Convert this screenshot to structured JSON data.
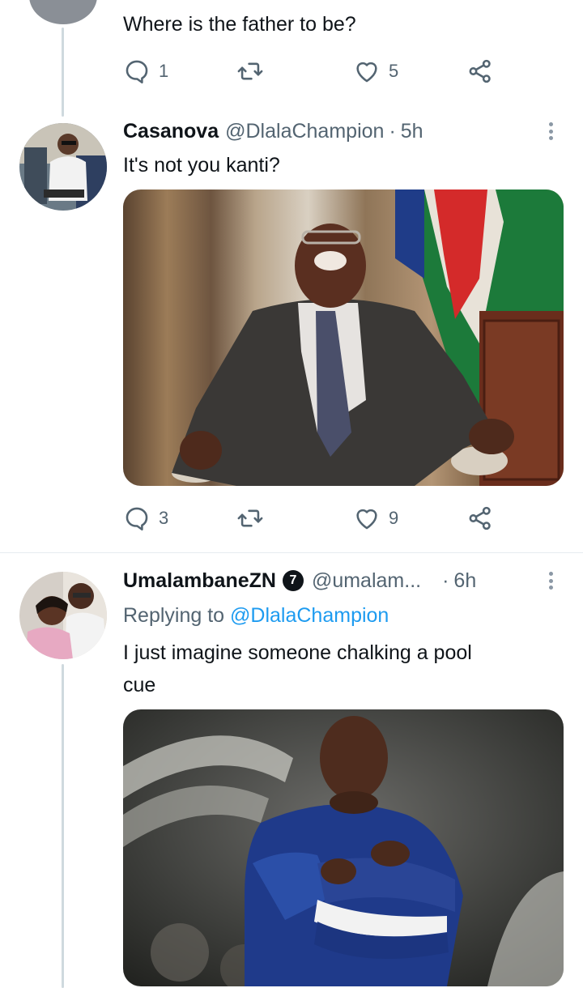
{
  "parent_tweet": {
    "text": "Where is the father to be?",
    "replies": "1",
    "retweets": "",
    "likes": "5"
  },
  "tweet1": {
    "name": "Casanova",
    "handle": "@DlalaChampion",
    "separator": "·",
    "time": "5h",
    "text": "It's not you kanti?",
    "replies": "3",
    "retweets": "",
    "likes": "9"
  },
  "tweet2": {
    "name": "UmalambaneZN",
    "badge": "7",
    "handle": "@umalam...",
    "separator": "·",
    "time": "6h",
    "replying_prefix": "Replying to",
    "replying_handle": "@DlalaChampion",
    "text_line1": "I just imagine someone chalking a pool",
    "text_line2": "cue"
  },
  "icons": {
    "reply": "reply-icon",
    "retweet": "retweet-icon",
    "like": "heart-icon",
    "share": "share-icon",
    "more": "more-options-icon"
  },
  "colors": {
    "text": "#0f1419",
    "secondary": "#536471",
    "link": "#1d9bf0",
    "divider": "#e6ecf0",
    "thread_line": "#cfd9de"
  }
}
